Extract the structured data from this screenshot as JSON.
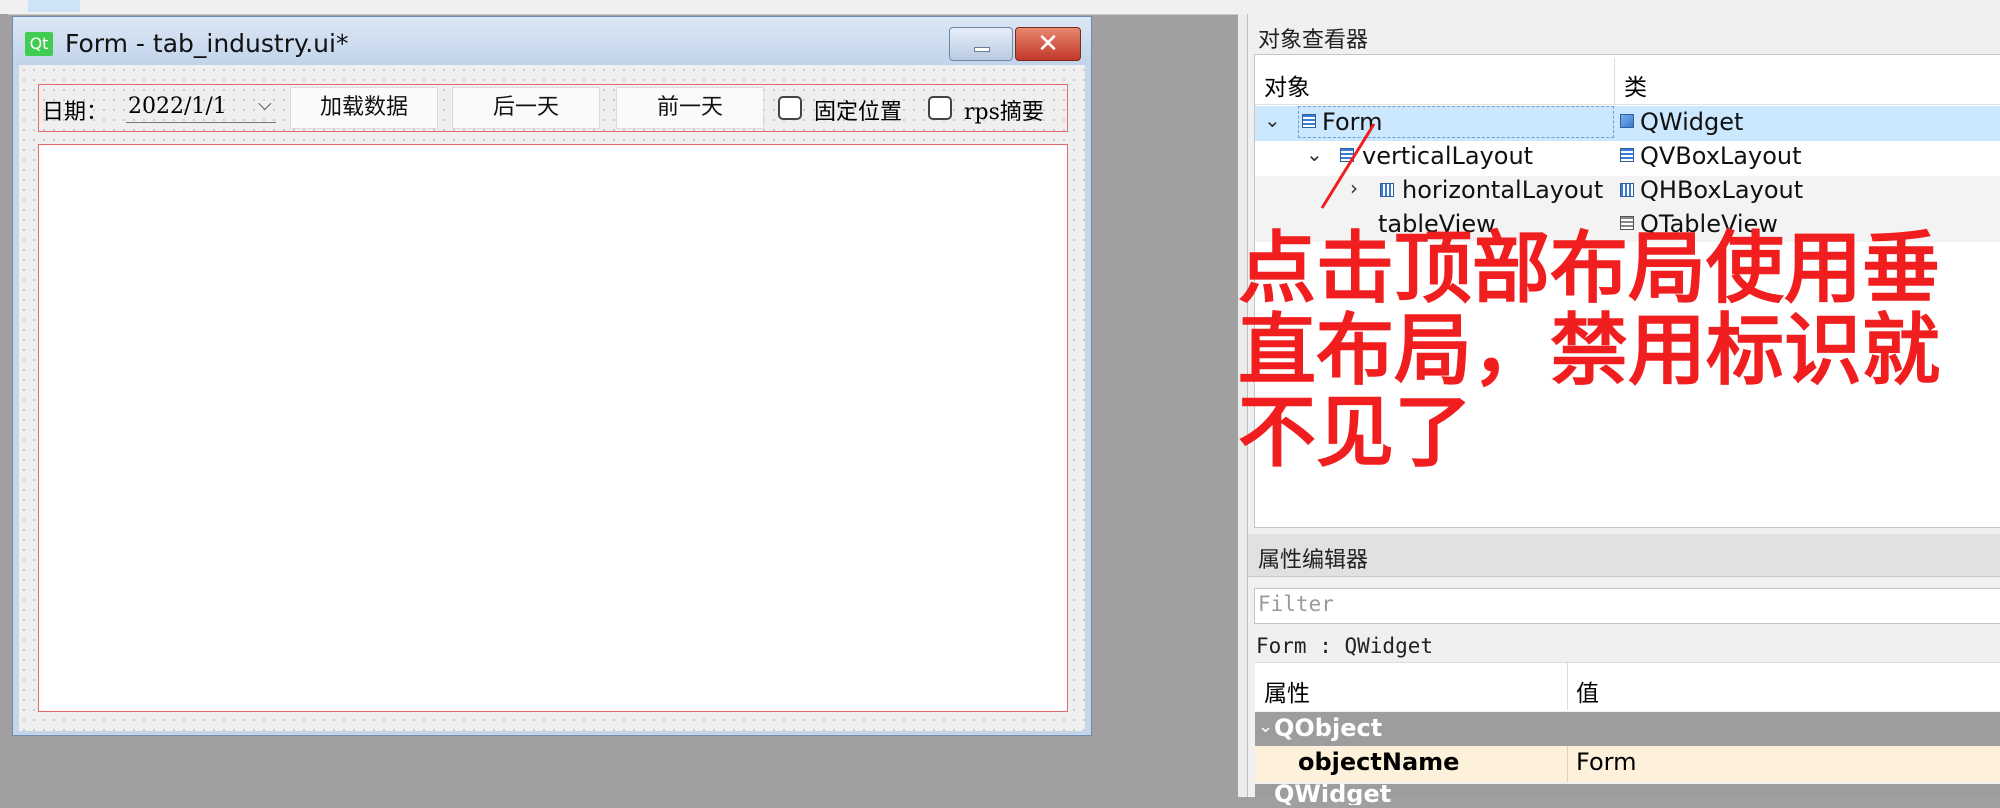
{
  "window": {
    "title": "Form - tab_industry.ui*",
    "logo_text": "Qt",
    "close_glyph": "✕"
  },
  "form": {
    "date_label": "日期：",
    "date_value": "2022/1/1",
    "date_arrow": "⌵",
    "buttons": {
      "load": "加载数据",
      "next_day": "后一天",
      "prev_day": "前一天"
    },
    "checkboxes": {
      "fixed": "固定位置",
      "rps": "rps摘要"
    }
  },
  "object_inspector": {
    "title": "对象查看器",
    "headers": {
      "object": "对象",
      "class": "类"
    },
    "rows": [
      {
        "name": "Form",
        "class": "QWidget",
        "expanded": true,
        "selected": true
      },
      {
        "name": "verticalLayout",
        "class": "QVBoxLayout",
        "expanded": true
      },
      {
        "name": "horizontalLayout",
        "class": "QHBoxLayout",
        "expanded": false
      },
      {
        "name": "tableView",
        "class": "QTableView"
      }
    ],
    "chev_open": "⌄",
    "chev_closed": "›"
  },
  "property_editor": {
    "title": "属性编辑器",
    "filter_placeholder": "Filter",
    "context": "Form : QWidget",
    "headers": {
      "property": "属性",
      "value": "值"
    },
    "groups": [
      {
        "name": "QObject",
        "properties": [
          {
            "key": "objectName",
            "value": "Form"
          }
        ]
      },
      {
        "name": "QWidget"
      }
    ]
  },
  "annotation": {
    "lines": [
      "点击顶部布局使用垂",
      "直布局，禁用标识就",
      "不见了"
    ],
    "color": "#f01e1e"
  }
}
